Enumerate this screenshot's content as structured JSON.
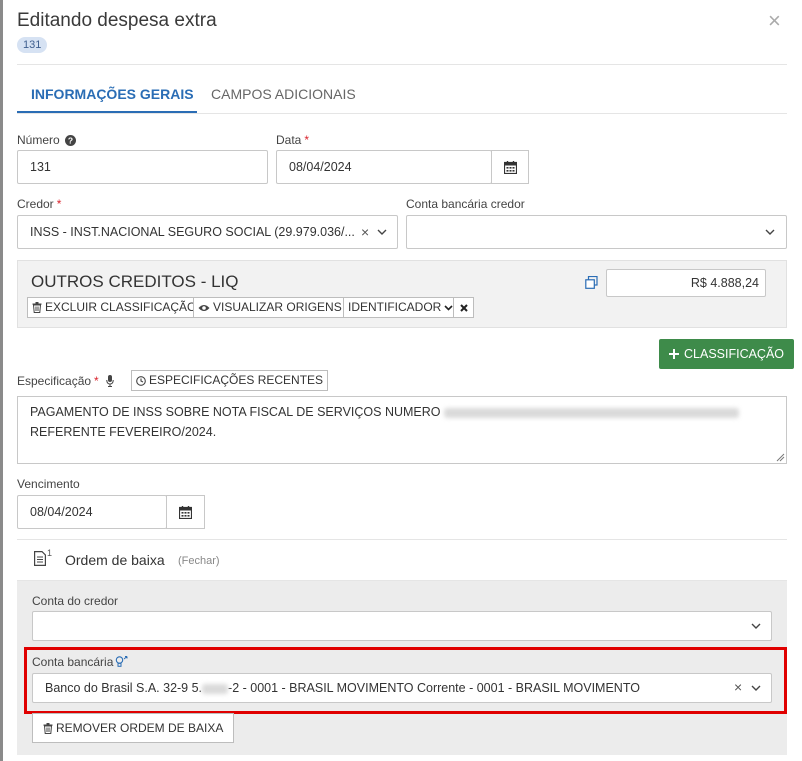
{
  "dialog": {
    "title": "Editando despesa extra",
    "badge": "131",
    "close_icon": "×"
  },
  "tabs": [
    {
      "label": "INFORMAÇÕES GERAIS",
      "active": true
    },
    {
      "label": "CAMPOS ADICIONAIS",
      "active": false
    }
  ],
  "form": {
    "numero": {
      "label": "Número",
      "value": "131"
    },
    "data": {
      "label": "Data",
      "required_mark": "*",
      "value": "08/04/2024"
    },
    "credor": {
      "label": "Credor",
      "required_mark": "*",
      "value": "INSS - INST.NACIONAL SEGURO SOCIAL (29.979.036/..."
    },
    "conta_bancaria_credor": {
      "label": "Conta bancária credor",
      "value": ""
    }
  },
  "classificacao": {
    "title": "OUTROS CREDITOS - LIQ",
    "amount": "R$ 4.888,24",
    "buttons": {
      "excluir": "EXCLUIR CLASSIFICAÇÃO",
      "visualizar": "VISUALIZAR ORIGENS",
      "identificador": "IDENTIFICADOR"
    },
    "add_button": "CLASSIFICAÇÃO"
  },
  "especificacao": {
    "label": "Especificação",
    "required_mark": "*",
    "recentes_button": "ESPECIFICAÇÕES RECENTES",
    "line1": "PAGAMENTO DE INSS SOBRE NOTA FISCAL DE SERVIÇOS NUMERO",
    "line2": "REFERENTE FEVEREIRO/2024."
  },
  "vencimento": {
    "label": "Vencimento",
    "value": "08/04/2024"
  },
  "ordem_baixa": {
    "count": "1",
    "title": "Ordem de baixa",
    "fechar": "(Fechar)",
    "conta_credor_label": "Conta do credor",
    "conta_credor_value": "",
    "conta_bancaria_label": "Conta bancária",
    "conta_bancaria_value_part1": "Banco do Brasil S.A. 32-9 5.",
    "conta_bancaria_value_part2": "-2 - 0001 - BRASIL MOVIMENTO Corrente - 0001 - BRASIL MOVIMENTO",
    "remover_button": "REMOVER ORDEM DE BAIXA"
  },
  "colors": {
    "accent": "#2a6db5",
    "green": "#3e8b4a",
    "highlight": "#e00000",
    "required": "#d9232d"
  }
}
